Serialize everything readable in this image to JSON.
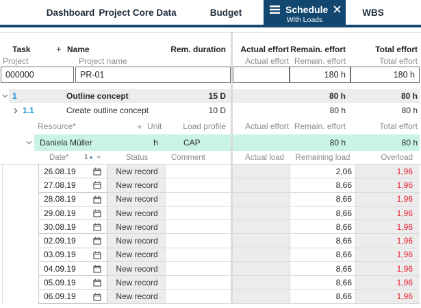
{
  "colors": {
    "accent_navy": "#12486f",
    "selection_green": "#c9f4e4",
    "overload_red": "#e8192e",
    "task_number_blue": "#1095d2",
    "row_gray": "#ececec"
  },
  "tabs": {
    "items": [
      {
        "label": "Dashboard"
      },
      {
        "label": "Project Core Data"
      },
      {
        "label": "Budget"
      },
      {
        "label": "Schedule",
        "subtitle": "With Loads",
        "active": true
      },
      {
        "label": "WBS"
      }
    ]
  },
  "task_table": {
    "header": {
      "task": "Task",
      "plus": "+",
      "name": "Name",
      "rem_duration": "Rem. duration",
      "actual_effort": "Actual effort",
      "remain_effort": "Remain. effort",
      "total_effort": "Total effort"
    },
    "subheader": {
      "project": "Project",
      "project_name": "Project name",
      "actual_effort": "Actual effort",
      "remain_effort": "Remain. effort",
      "total_effort": "Total effort"
    },
    "project_row": {
      "id": "000000",
      "name": "PR-01",
      "actual": "",
      "remaining": "180 h",
      "total": "180 h"
    },
    "rows": [
      {
        "num": "1",
        "name": "Outline concept",
        "duration": "15 D",
        "remaining": "80 h",
        "total": "80 h"
      },
      {
        "num": "1.1",
        "name": "Create outline concept",
        "duration": "10 D",
        "remaining": "80 h",
        "total": "80 h"
      }
    ]
  },
  "resource_table": {
    "header": {
      "resource": "Resource*",
      "plus": "+",
      "unit": "Unit",
      "load_profile": "Load profile",
      "actual_effort": "Actual effort",
      "remain_effort": "Remain. effort",
      "total_effort": "Total effort"
    },
    "row": {
      "name": "Daniela Müller",
      "unit": "h",
      "load_profile": "CAP",
      "remaining": "80 h",
      "total": "80 h"
    }
  },
  "load_table": {
    "header": {
      "date": "Date*",
      "sort": "1",
      "plus": "+",
      "status": "Status",
      "comment": "Comment",
      "actual_load": "Actual load",
      "remaining_load": "Remaining load",
      "overload": "Overload"
    },
    "rows": [
      {
        "date": "26.08.19",
        "status": "New record",
        "comment": "",
        "actual": "",
        "remaining": "2,06",
        "overload": "1,96"
      },
      {
        "date": "27.08.19",
        "status": "New record",
        "comment": "",
        "actual": "",
        "remaining": "8,66",
        "overload": "1,96"
      },
      {
        "date": "28.08.19",
        "status": "New record",
        "comment": "",
        "actual": "",
        "remaining": "8,66",
        "overload": "1,96"
      },
      {
        "date": "29.08.19",
        "status": "New record",
        "comment": "",
        "actual": "",
        "remaining": "8,66",
        "overload": "1,96"
      },
      {
        "date": "30.08.19",
        "status": "New record",
        "comment": "",
        "actual": "",
        "remaining": "8,66",
        "overload": "1,96"
      },
      {
        "date": "02.09.19",
        "status": "New record",
        "comment": "",
        "actual": "",
        "remaining": "8,66",
        "overload": "1,96"
      },
      {
        "date": "03.09.19",
        "status": "New record",
        "comment": "",
        "actual": "",
        "remaining": "8,66",
        "overload": "1,96"
      },
      {
        "date": "04.09.19",
        "status": "New record",
        "comment": "",
        "actual": "",
        "remaining": "8,66",
        "overload": "1,96"
      },
      {
        "date": "05.09.19",
        "status": "New record",
        "comment": "",
        "actual": "",
        "remaining": "8,66",
        "overload": "1,96"
      },
      {
        "date": "06.09.19",
        "status": "New record",
        "comment": "",
        "actual": "",
        "remaining": "8,66",
        "overload": "1,96"
      }
    ]
  }
}
